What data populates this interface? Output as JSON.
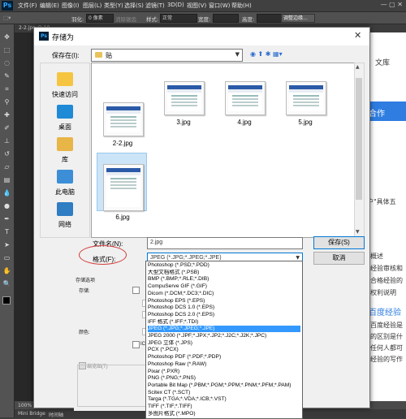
{
  "app": {
    "logo": "Ps",
    "menu": [
      "文件(F)",
      "编辑(E)",
      "图像(I)",
      "图层(L)",
      "类型(Y)",
      "选择(S)",
      "滤镜(T)",
      "3D(D)",
      "视图(V)",
      "窗口(W)",
      "帮助(H)"
    ],
    "window_controls": "— ▢ ✕"
  },
  "options_bar": {
    "feather_label": "羽化:",
    "feather_value": "0 像素",
    "antialias_label": "消除锯齿",
    "style_label": "样式:",
    "style_value": "正常",
    "width_label": "宽度:",
    "height_label": "高度:",
    "refine_button": "调整边缘..."
  },
  "document_tab": "2-2.jpg @ 10...",
  "right_doc": {
    "text1": "文库",
    "text2": "合作",
    "text3": "用户\"具体五",
    "lines": [
      "概述",
      "经验审核和",
      "合格经验的",
      "权利说明"
    ],
    "heading": "百度经验",
    "para": [
      "百度经验是",
      "的区别是什",
      "任何人都可",
      "经验的写作"
    ]
  },
  "status_bar": "100%",
  "bottom_tabs": [
    "Mini Bridge",
    "时间轴"
  ],
  "dialog": {
    "logo": "Ps",
    "title": "存储为",
    "close": "✕",
    "save_in_label": "保存在(I):",
    "save_in_value": "贴",
    "places": [
      {
        "label": "快速访问",
        "icon": "quick-access-icon",
        "color": "#f5c542"
      },
      {
        "label": "桌面",
        "icon": "desktop-icon",
        "color": "#1f8ad6"
      },
      {
        "label": "库",
        "icon": "library-icon",
        "color": "#e8b547"
      },
      {
        "label": "此电脑",
        "icon": "computer-icon",
        "color": "#3c8fd6"
      },
      {
        "label": "网络",
        "icon": "network-icon",
        "color": "#2f7dc2"
      }
    ],
    "files": [
      "2-2.jpg",
      "3.jpg",
      "4.jpg",
      "5.jpg",
      "6.jpg"
    ],
    "filename_label": "文件名(N):",
    "filename_value": "2.jpg",
    "format_label": "格式(F):",
    "format_value": "JPEG (*.JPG;*.JPEG;*.JPE)",
    "save_button": "保存(S)",
    "cancel_button": "取消",
    "options": {
      "section": "存储选项",
      "store_label": "存储:",
      "color_label": "颜色:",
      "thumbnail_label": "缩览图(T)",
      "icc_label": "IC"
    },
    "format_list": [
      "Photoshop (*.PSD;*.PDD)",
      "大型文档格式 (*.PSB)",
      "BMP (*.BMP;*.RLE;*.DIB)",
      "CompuServe GIF (*.GIF)",
      "Dicom (*.DCM;*.DC3;*.DIC)",
      "Photoshop EPS (*.EPS)",
      "Photoshop DCS 1.0 (*.EPS)",
      "Photoshop DCS 2.0 (*.EPS)",
      "IFF 格式 (*.IFF;*.TDI)",
      "JPEG (*.JPG;*.JPEG;*.JPE)",
      "JPEG 2000 (*.JPF;*.JPX;*.JP2;*.J2C;*.J2K;*.JPC)",
      "JPEG 立体 (*.JPS)",
      "PCX (*.PCX)",
      "Photoshop PDF (*.PDF;*.PDP)",
      "Photoshop Raw (*.RAW)",
      "Pixar (*.PXR)",
      "PNG (*.PNG;*.PNS)",
      "Portable Bit Map (*.PBM;*.PGM;*.PPM;*.PNM;*.PFM;*.PAM)",
      "Scitex CT (*.SCT)",
      "Targa (*.TGA;*.VDA;*.ICB;*.VST)",
      "TIFF (*.TIF;*.TIFF)",
      "多图片格式 (*.MPO)"
    ],
    "selected_format_index": 9
  }
}
